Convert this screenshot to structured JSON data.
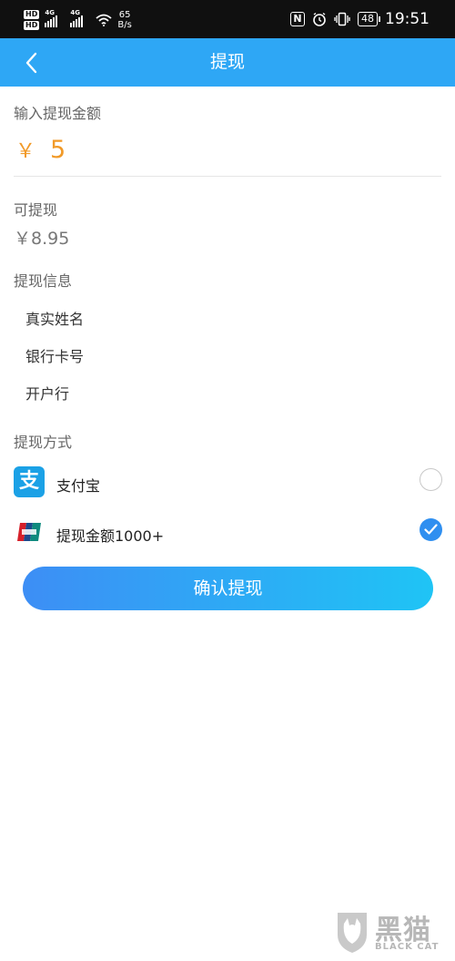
{
  "status_bar": {
    "hd1": "HD",
    "hd2": "HD",
    "net1": "4G",
    "net2": "4G",
    "speed_value": "65",
    "speed_unit": "B/s",
    "nfc": "N",
    "battery": "48",
    "time": "19:51"
  },
  "header": {
    "title": "提现"
  },
  "amount_section": {
    "label": "输入提现金额",
    "currency": "￥",
    "value": "5"
  },
  "available": {
    "label": "可提现",
    "value": "￥8.95"
  },
  "info_section": {
    "label": "提现信息",
    "fields": [
      "真实姓名",
      "银行卡号",
      "开户行"
    ]
  },
  "method_section": {
    "label": "提现方式",
    "methods": [
      {
        "label": "支付宝",
        "icon": "alipay-icon",
        "icon_char": "支",
        "selected": false
      },
      {
        "label": "提现金额1000+",
        "icon": "unionpay-icon",
        "selected": true
      }
    ]
  },
  "confirm_button": {
    "label": "确认提现"
  },
  "watermark": {
    "text": "黑猫",
    "sub": "BLACK CAT"
  },
  "colors": {
    "header": "#2ea7f5",
    "amount": "#f19a29",
    "radio_checked": "#2f8ff0",
    "button_start": "#3d8ef5",
    "button_end": "#1fc4f5"
  }
}
